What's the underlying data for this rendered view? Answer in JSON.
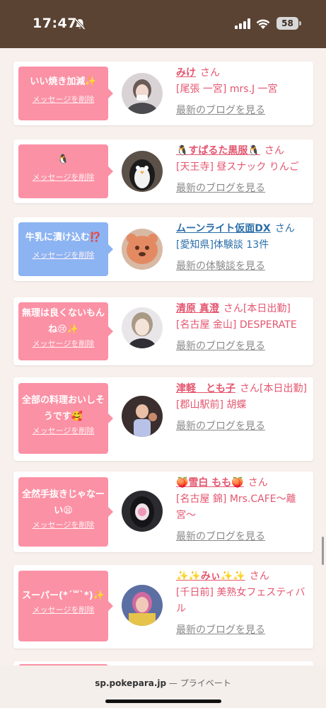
{
  "status_bar": {
    "time": "17:47",
    "battery": "58"
  },
  "cards": [
    {
      "message": "いい焼き加減✨",
      "delete_label": "メッセージを削除",
      "name": "みけ",
      "honorific": "さん",
      "detail": "[尾張 一宮] mrs.J 一宮",
      "link": "最新のブログを見る"
    },
    {
      "message": "🐧",
      "delete_label": "メッセージを削除",
      "name": "🐧すぱるた黒服🐧",
      "honorific": "さん",
      "detail": "[天王寺] 昼スナック りんご",
      "link": "最新のブログを見る"
    },
    {
      "message": "牛乳に漬け込む⁉️",
      "delete_label": "メッセージを削除",
      "name": "ムーンライト仮面DX",
      "honorific": "さん",
      "detail": "[愛知県]体験談 13件",
      "link": "最新の体験談を見る"
    },
    {
      "message": "無理は良くないもんね😢✨",
      "delete_label": "メッセージを削除",
      "name": "清原 真澄",
      "honorific": "さん[本日出勤]",
      "detail": "[名古屋 金山] DESPERATE",
      "link": "最新のブログを見る"
    },
    {
      "message": "全部の料理おいしそうです🥰",
      "delete_label": "メッセージを削除",
      "name": "津軽　とも子",
      "honorific": "さん[本日出勤]",
      "detail": "[郡山駅前] 胡蝶",
      "link": "最新のブログを見る"
    },
    {
      "message": "全然手抜きじゃなーい😫",
      "delete_label": "メッセージを削除",
      "name": "🍑雪白 もも🍑",
      "honorific": "さん",
      "detail": "[名古屋 錦] Mrs.CAFE〜離宮〜",
      "link": "最新のブログを見る"
    },
    {
      "message": "スーパー(*´꒳`*)✨",
      "delete_label": "メッセージを削除",
      "name": "✨✨みぃ✨✨",
      "honorific": "さん",
      "detail": "[千日前] 美熟女フェスティバル",
      "link": "最新のブログを見る"
    }
  ],
  "browser": {
    "host": "sp.pokepara.jp",
    "separator": " — ",
    "mode": "プライベート"
  },
  "colors": {
    "status_bar": "#5a4333",
    "bubble_pink": "#fb91a5",
    "bubble_blue": "#8cb3f2",
    "name_pink": "#e4566f",
    "name_blue": "#2b6ea8",
    "link_gray": "#8a8a8a"
  },
  "icons": [
    "bell-slash-icon",
    "signal-icon",
    "wifi-icon",
    "battery-icon"
  ]
}
